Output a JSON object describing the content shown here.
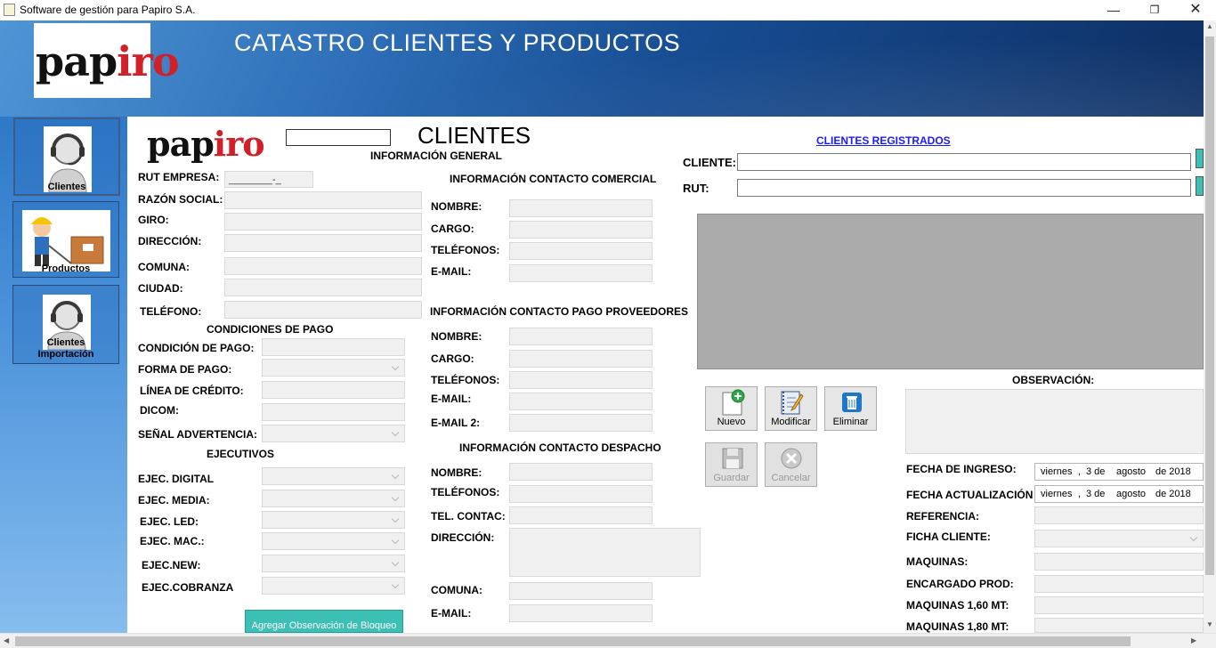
{
  "window": {
    "title": "Software de gestión para Papiro S.A."
  },
  "header": {
    "logo": "papiro",
    "title": "CATASTRO CLIENTES Y PRODUCTOS"
  },
  "sidebar": {
    "items": [
      {
        "label": "Clientes"
      },
      {
        "label": "Productos"
      },
      {
        "label": "Clientes Importación"
      }
    ]
  },
  "form": {
    "logo": "papiro",
    "title": "CLIENTES",
    "general": {
      "heading": "INFORMACIÓN GENERAL",
      "rut_label": "RUT EMPRESA:",
      "rut_mask": "________-_",
      "razon_label": "RAZÓN SOCIAL:",
      "giro_label": "GIRO:",
      "direccion_label": "DIRECCIÓN:",
      "comuna_label": "COMUNA:",
      "ciudad_label": "CIUDAD:",
      "telefono_label": "TELÉFONO:"
    },
    "pago": {
      "heading": "CONDICIONES DE PAGO",
      "condicion_label": "CONDICIÓN DE PAGO:",
      "forma_label": "FORMA DE PAGO:",
      "linea_label": "LÍNEA DE CRÉDITO:",
      "dicom_label": "DICOM:",
      "senal_label": "SEÑAL ADVERTENCIA:"
    },
    "ejecutivos": {
      "heading": "EJECUTIVOS",
      "digital": "EJEC. DIGITAL",
      "media": "EJEC. MEDIA:",
      "led": "EJEC. LED:",
      "mac": "EJEC. MAC.:",
      "new": "EJEC.NEW:",
      "cobranza": "EJEC.COBRANZA"
    },
    "agregar_obs_button": "Agregar Observación de Bloqueo",
    "comercial": {
      "heading": "INFORMACIÓN CONTACTO COMERCIAL",
      "nombre": "NOMBRE:",
      "cargo": "CARGO:",
      "telefonos": "TELÉFONOS:",
      "email": "E-MAIL:"
    },
    "proveedores": {
      "heading": "INFORMACIÓN CONTACTO PAGO PROVEEDORES",
      "nombre": "NOMBRE:",
      "cargo": "CARGO:",
      "telefonos": "TELÉFONOS:",
      "email": "E-MAIL:",
      "email2": "E-MAIL 2:"
    },
    "despacho": {
      "heading": "INFORMACIÓN CONTACTO DESPACHO",
      "nombre": "NOMBRE:",
      "telefonos": "TELÉFONOS:",
      "tel_contac": "TEL. CONTAC:",
      "direccion": "DIRECCIÓN:",
      "comuna": "COMUNA:",
      "email": "E-MAIL:"
    },
    "registrados": {
      "link": "CLIENTES REGISTRADOS",
      "cliente_label": "CLIENTE:",
      "rut_label": "RUT:"
    },
    "toolbar": {
      "nuevo": "Nuevo",
      "modificar": "Modificar",
      "eliminar": "Eliminar",
      "guardar": "Guardar",
      "cancelar": "Cancelar"
    },
    "extra": {
      "observacion_label": "OBSERVACIÓN:",
      "fecha_ingreso_label": "FECHA DE INGRESO:",
      "fecha_ingreso": {
        "weekday": "viernes",
        "sep": ",",
        "day": "3 de",
        "month": "agosto",
        "year": "de 2018"
      },
      "fecha_act_label": "FECHA ACTUALIZACIÓN",
      "fecha_act": {
        "weekday": "viernes",
        "sep": ",",
        "day": "3 de",
        "month": "agosto",
        "year": "de 2018"
      },
      "referencia_label": "REFERENCIA:",
      "ficha_label": "FICHA CLIENTE:",
      "maquinas_label": "MAQUINAS:",
      "encargado_label": "ENCARGADO PROD:",
      "maq160_label": "MAQUINAS 1,60 MT:",
      "maq180_label": "MAQUINAS 1,80 MT:"
    }
  },
  "colors": {
    "logo_red": "#d0202a",
    "logo_dark": "#111111",
    "link": "#1a1aff",
    "accent_button": "#3cc0b6"
  }
}
